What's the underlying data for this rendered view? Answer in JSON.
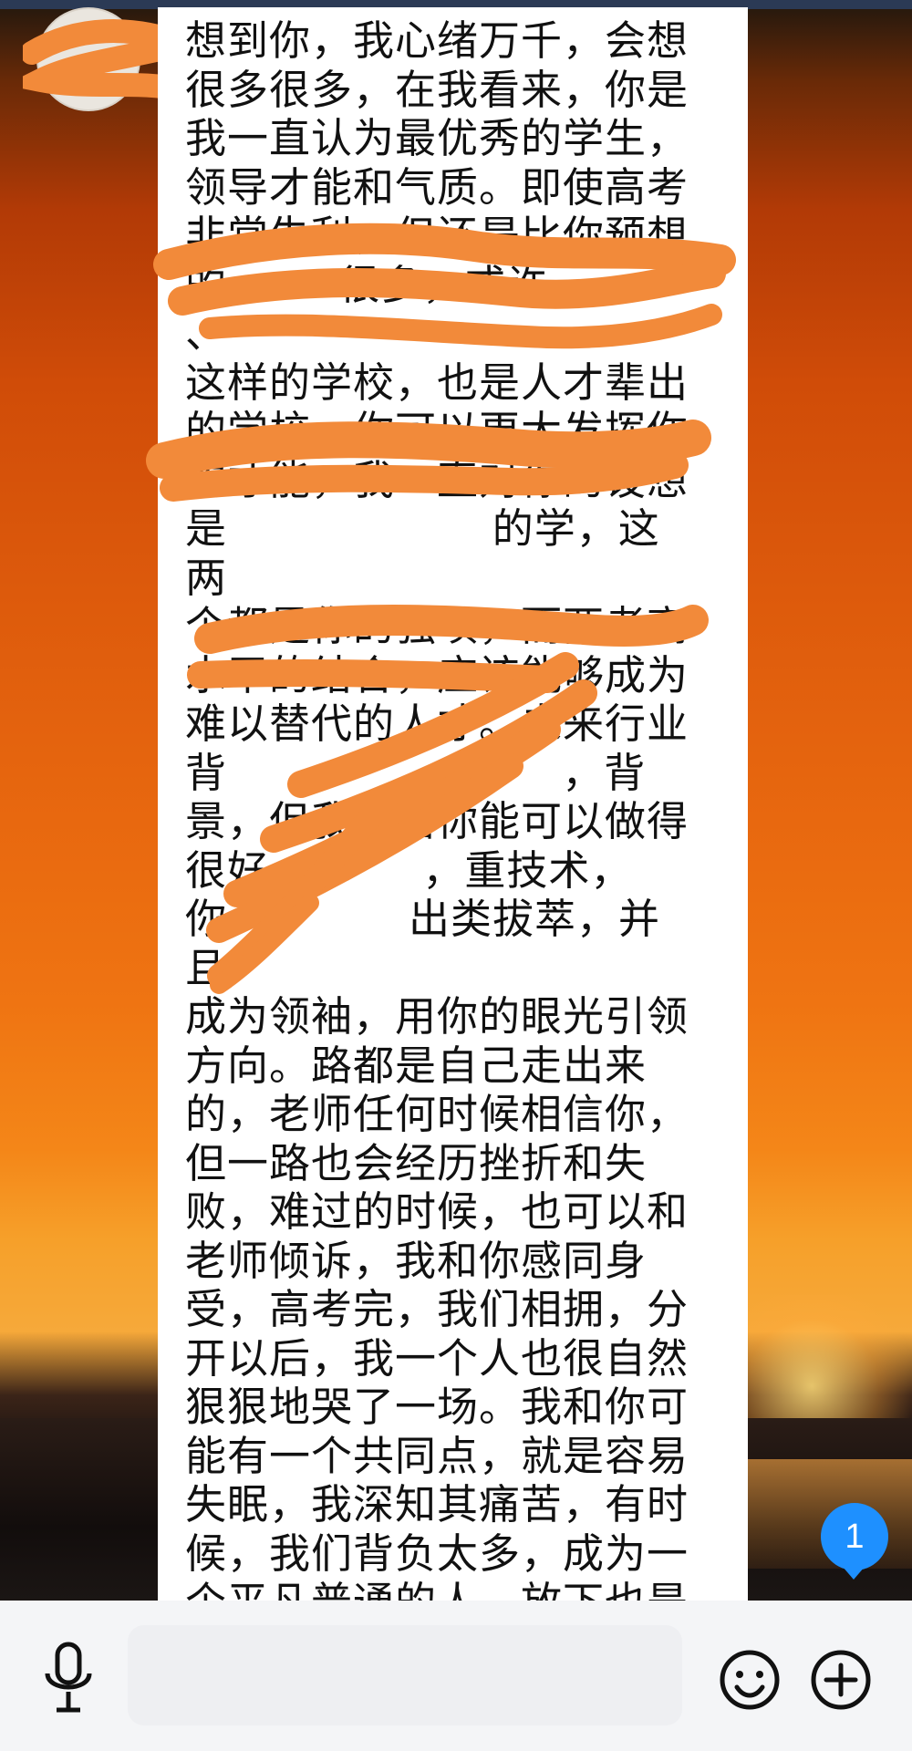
{
  "conversation": {
    "message_text": "想到你，我心绪万千，会想\n很多很多，在我看来，你是\n我一直认为最优秀的学生，\n领导才能和气质。即使高考\n非常失利，但还是比你预想\n的        很多，或许         、\n这样的学校，也是人才辈出\n的学校，你可以更大发挥你\n的才能，我一直对你的设想\n是                   的学，这两\n个都是你的强项，而两者高\n水平的结合，应该能够成为\n难以替代的人才。未来行业\n背                        ，背\n景，但我相信你能可以做得\n很好           ，重技术，\n你             出类拔萃，并且\n成为领袖，用你的眼光引领\n方向。路都是自己走出来\n的，老师任何时候相信你，\n但一路也会经历挫折和失\n败，难过的时候，也可以和\n老师倾诉，我和你感同身\n受，高考完，我们相拥，分\n开以后，我一个人也很自然\n狠狠地哭了一场。我和你可\n能有一个共同点，就是容易\n失眠，我深知其痛苦，有时\n候，我们背负太多，成为一\n个平凡普通的人，放下也是\n幸福的，甘于平凡也是一种\n境界。没有什么比健康和生",
    "unread_badge": "1"
  },
  "input_bar": {
    "placeholder": "",
    "mic_icon": "microphone-icon",
    "emoji_icon": "emoji-icon",
    "plus_icon": "plus-icon"
  },
  "colors": {
    "redaction": "#f28a3a",
    "badge": "#1e90ff",
    "bubble": "#ffffff"
  }
}
